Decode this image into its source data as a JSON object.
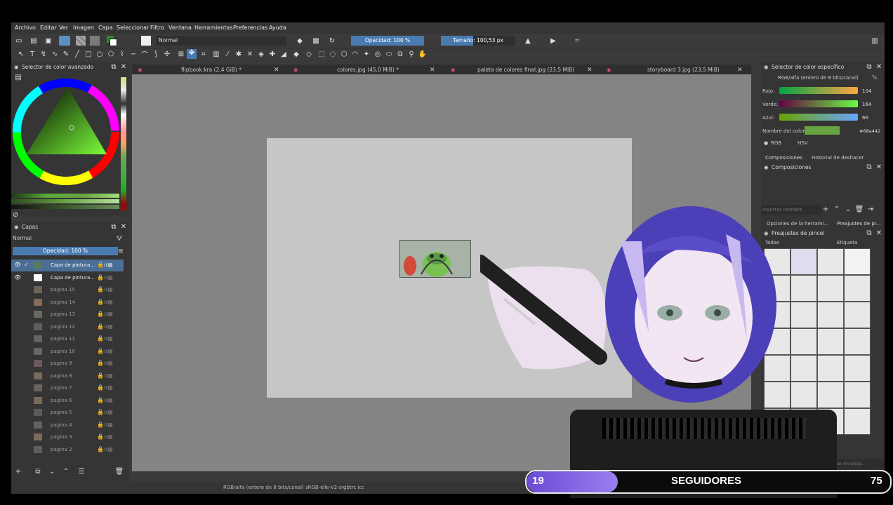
{
  "menu": [
    "Archivo",
    "Editar",
    "Ver",
    "Imagen",
    "Capa",
    "Seleccionar",
    "Filtro",
    "Ventana",
    "Herramientas",
    "Preferencias",
    "Ayuda"
  ],
  "toolbar": {
    "blend_mode": "Normal",
    "opacity_label": "Opacidad: 100 %",
    "size_label": "Tamaño: 100,53 px"
  },
  "tabs": [
    {
      "label": "flipbook.kra (2,4 GiB) *"
    },
    {
      "label": "colores.jpg (45,0 MiB) *"
    },
    {
      "label": "paleta de colores final.jpg (23,5 MiB)"
    },
    {
      "label": "storyboard 3.jpg (23,5 MiB)"
    }
  ],
  "advanced_color": {
    "title": "Selector de color avanzado"
  },
  "layers_panel": {
    "title": "Capas",
    "blend": "Normal",
    "opacity": "Opacidad:  100 %",
    "layers": [
      {
        "name": "Capa de pintura...",
        "active": true
      },
      {
        "name": "Capa de pintura...",
        "active": false
      },
      {
        "name": "pagina 15"
      },
      {
        "name": "pagina 14"
      },
      {
        "name": "pagina 13"
      },
      {
        "name": "pagina 12"
      },
      {
        "name": "pagina 11"
      },
      {
        "name": "pagina 10"
      },
      {
        "name": "pagina 9"
      },
      {
        "name": "pagina 8"
      },
      {
        "name": "pagina 7"
      },
      {
        "name": "pagina 6"
      },
      {
        "name": "pagina 5"
      },
      {
        "name": "pagina 4"
      },
      {
        "name": "pagina 3"
      },
      {
        "name": "pagina 2"
      }
    ]
  },
  "specific_color": {
    "title": "Selector de color específico",
    "mode": "RGB/alfa (entero de 8 bits/canal)",
    "red_label": "Rojo:",
    "red_value": "104",
    "green_label": "Verde:",
    "green_value": "164",
    "blue_label": "Azul:",
    "blue_value": "66",
    "name_label": "Nombre del color:",
    "hex": "#68a442",
    "rgb_option": "RGB",
    "hsv_option": "HSV",
    "swatch_color": "#68a442"
  },
  "compositions": {
    "tab1": "Composiciones",
    "tab2": "Historial de deshacer",
    "title": "Composiciones",
    "placeholder": "Insertar nombre"
  },
  "tool_options": {
    "tab1": "Opciones de la herrami...",
    "tab2": "Preajustes de pi..."
  },
  "brush_presets": {
    "title": "Preajustes de pincel",
    "filter": "Todas",
    "tag": "Etiqueta",
    "search_placeholder": "Filtrar en etiqu..."
  },
  "status_bar": {
    "text": "RGB/alfa (entero de 8 bits/canal)  sRGB-elle-V2-srgbtrc.icc"
  },
  "overlay": {
    "follower_count": "19",
    "label": "SEGUIDORES",
    "goal": "75",
    "progress": 0.25
  }
}
